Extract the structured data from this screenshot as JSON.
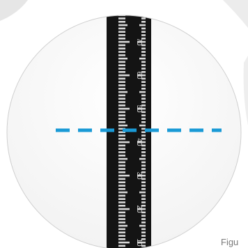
{
  "ruler": {
    "scale_labels": [
      "70",
      "60",
      "50",
      "40",
      "30",
      "20",
      "10"
    ],
    "tape_color": "#141414",
    "marking_color": "#d9d9d9"
  },
  "reference_line": {
    "color": "#1a9ad6",
    "style": "dashed"
  },
  "caption": {
    "text": "Figu"
  }
}
